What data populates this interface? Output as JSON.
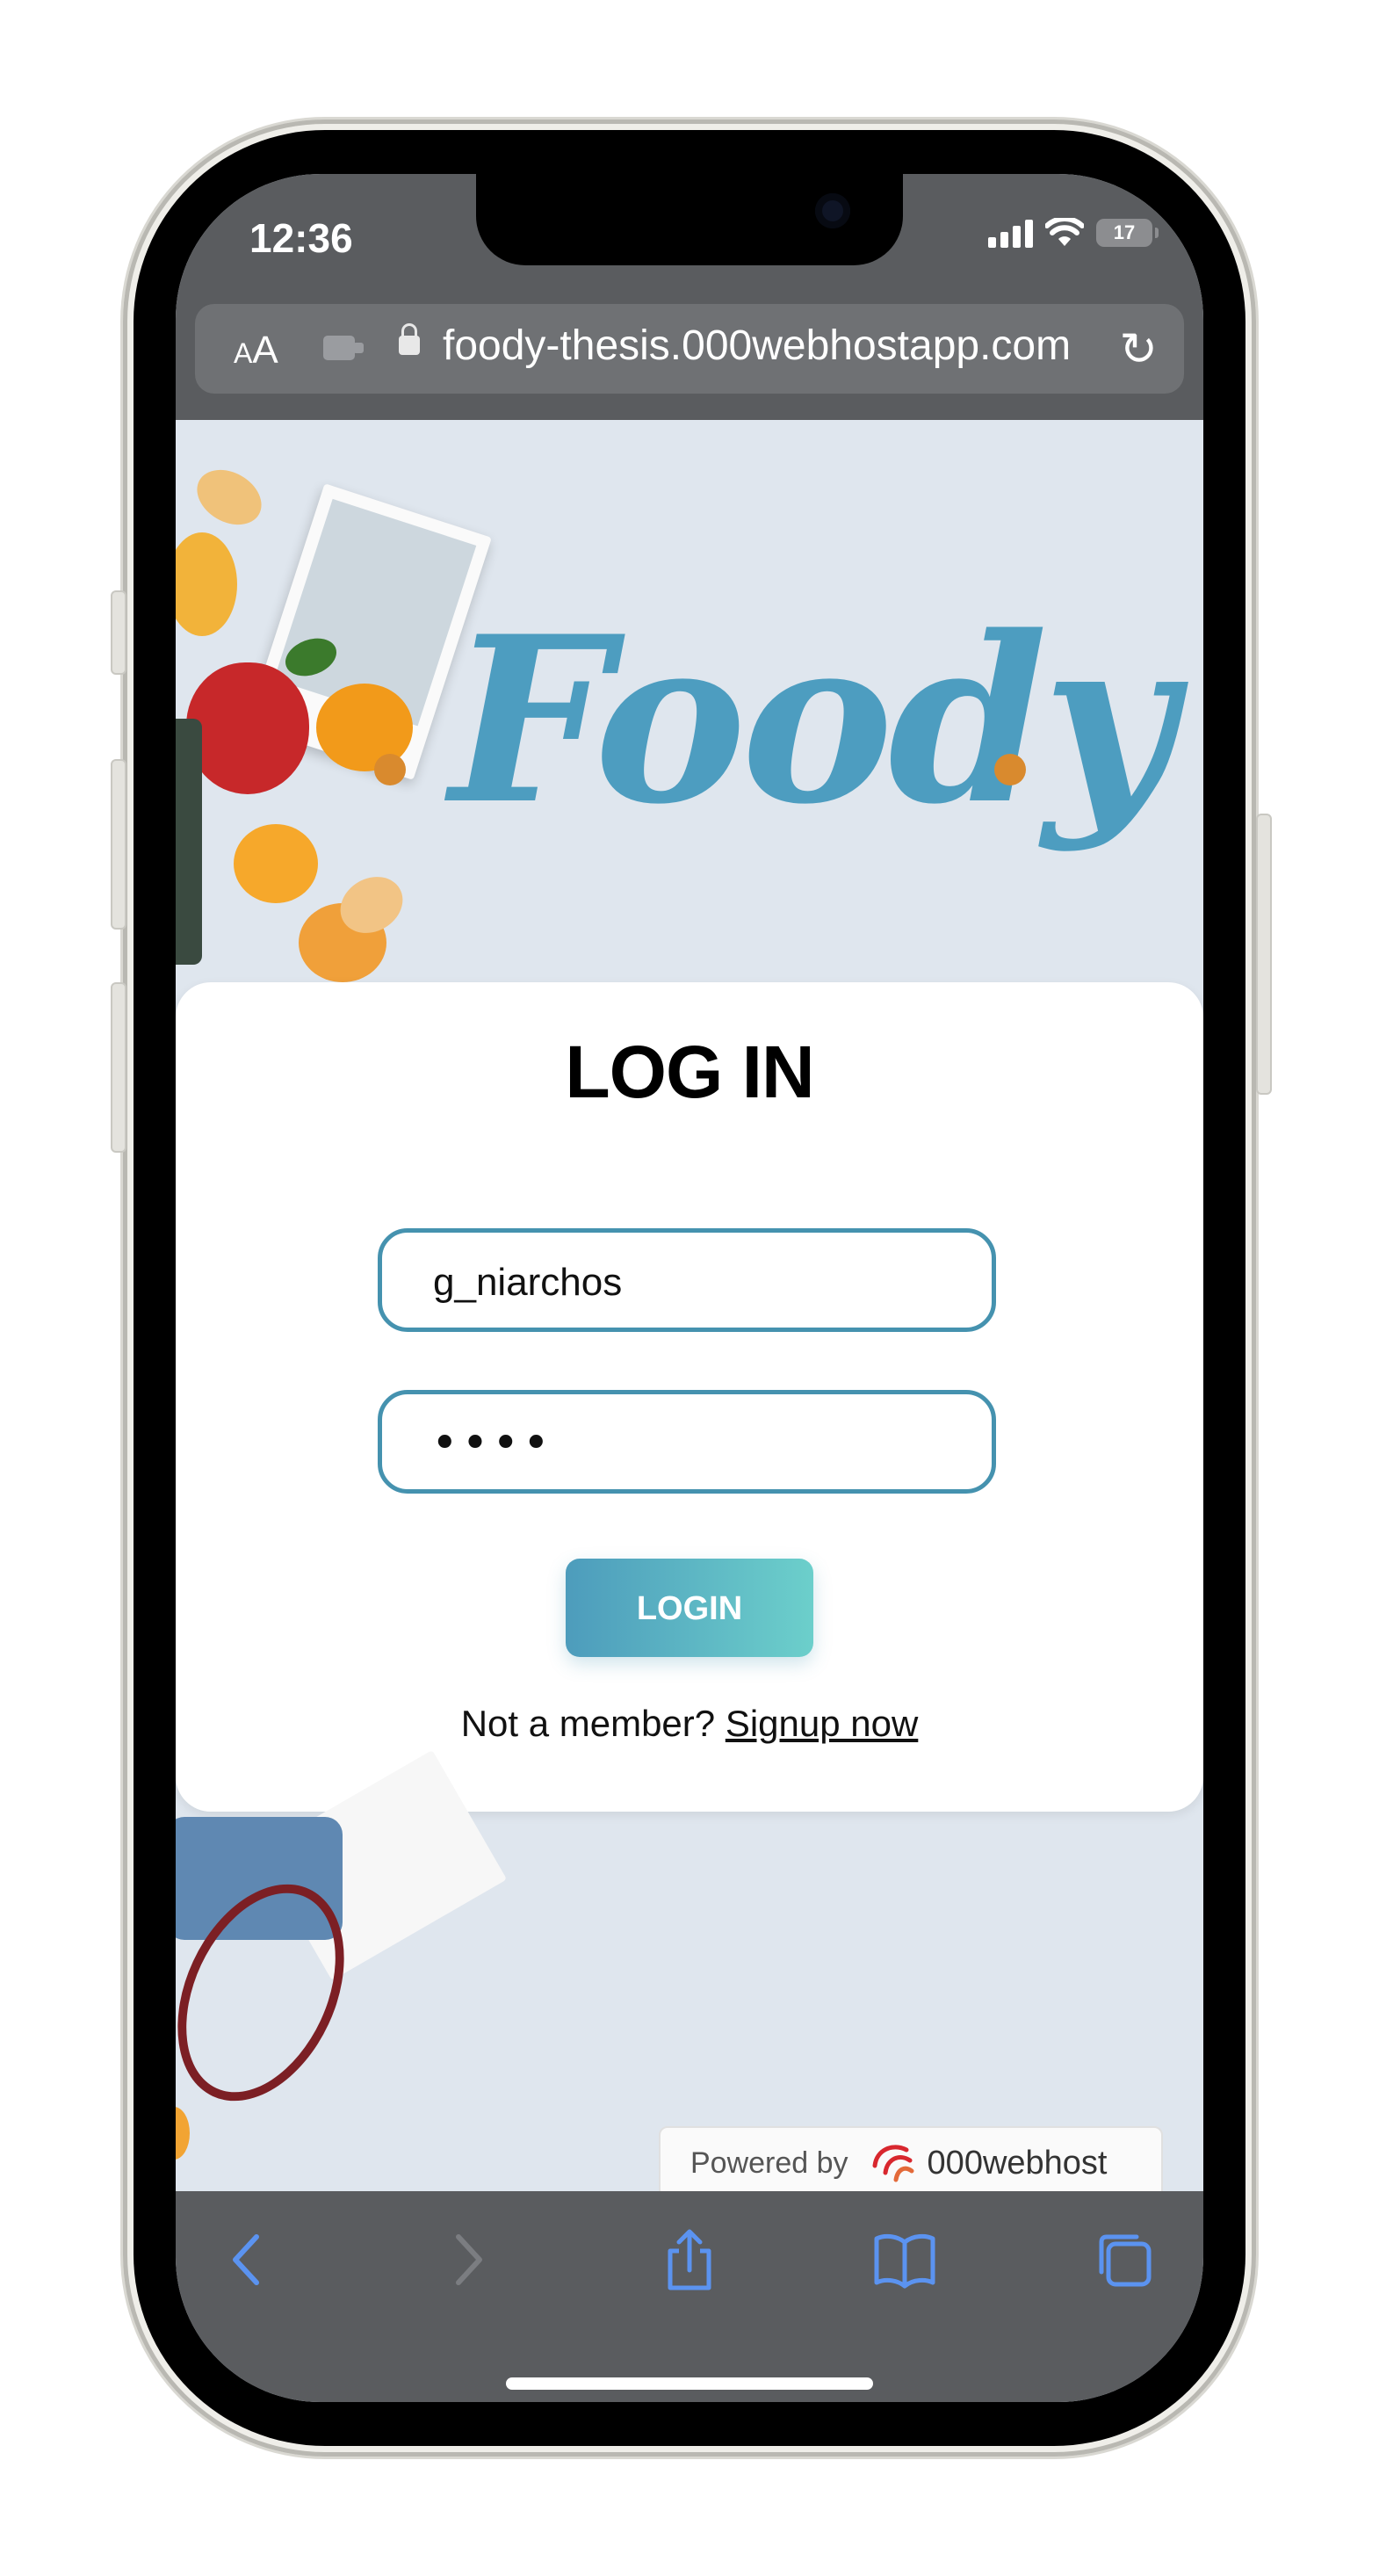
{
  "status_bar": {
    "time": "12:36",
    "battery": "17"
  },
  "browser": {
    "text_size_small": "A",
    "text_size_big": "A",
    "url": "foody-thesis.000webhostapp.com"
  },
  "page": {
    "logo": "Foody",
    "card": {
      "title": "LOG IN",
      "username_value": "g_niarchos",
      "password_value": "••••",
      "login_label": "LOGIN",
      "signup_prompt": "Not a member?",
      "signup_link": "Signup now"
    },
    "footer": {
      "powered_by": "Powered by",
      "brand": "000webhost"
    }
  },
  "colors": {
    "accent": "#4592af",
    "logo": "#4d9dc0",
    "logo_dot": "#d98a2e",
    "browser_chrome": "#5a5c5f",
    "toolbar_icon": "#5b93f0"
  },
  "toolbar": {
    "icons": [
      "back-icon",
      "forward-icon",
      "share-icon",
      "bookmarks-icon",
      "tabs-icon"
    ]
  }
}
